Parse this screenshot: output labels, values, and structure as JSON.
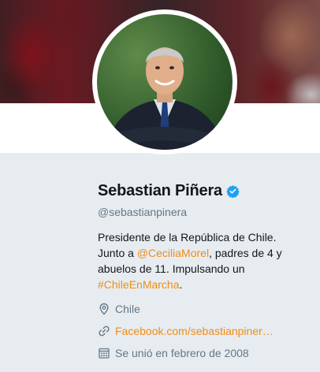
{
  "profile": {
    "name": "Sebastian Piñera",
    "handle": "@sebastianpinera",
    "verified": true
  },
  "bio": {
    "line1": "Presidente de la República de Chile.",
    "junto": "Junto a ",
    "mention": "@CeciliaMorel",
    "after_mention": ", padres de 4 y abuelos de 11. Impulsando un ",
    "hashtag": "#ChileEnMarcha",
    "end": "."
  },
  "meta": {
    "location": "Chile",
    "website": "Facebook.com/sebastianpiner…",
    "joined": "Se unió en febrero de 2008"
  },
  "icons": {
    "location": "location-pin-icon",
    "website": "link-icon",
    "joined": "calendar-icon",
    "verified": "verified-badge-icon"
  },
  "colors": {
    "link": "#f28c17",
    "verified": "#1da1f2",
    "secondary_text": "#657786",
    "background": "#e6ecf0"
  }
}
